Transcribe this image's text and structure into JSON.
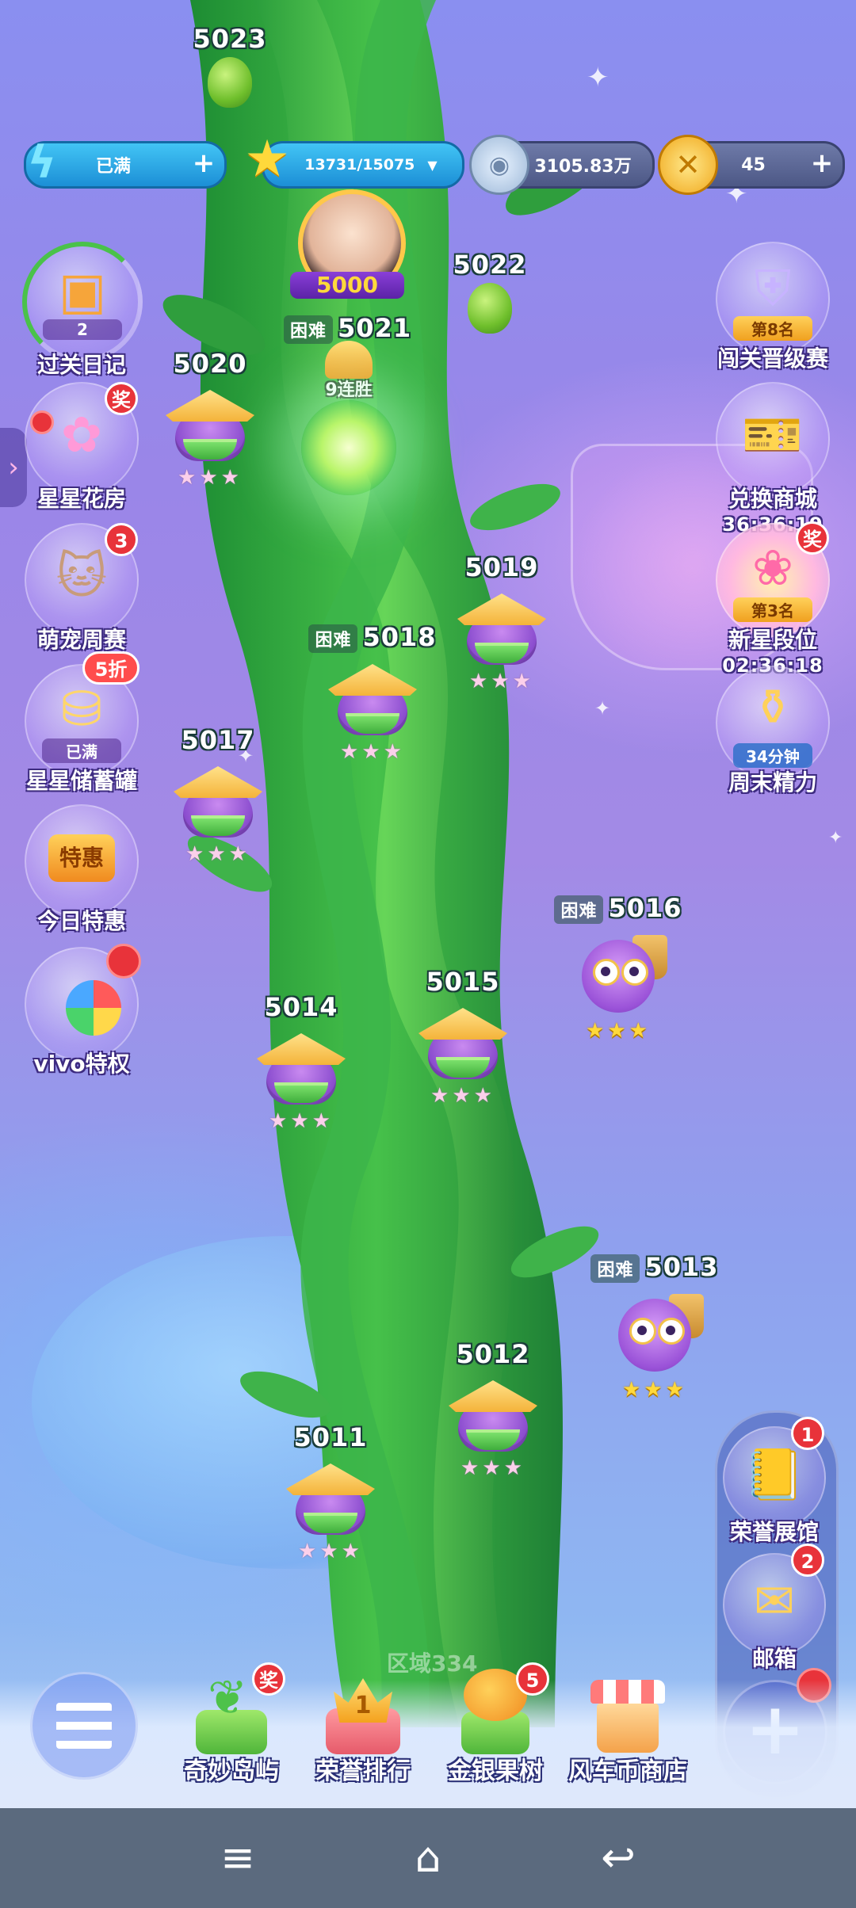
{
  "top_bar": {
    "energy": {
      "value": "已满",
      "icon": "lightning-icon"
    },
    "stars": {
      "value": "13731/15075",
      "icon": "star-icon"
    },
    "coins": {
      "value": "3105.83万",
      "icon": "silver-coin-icon"
    },
    "gold": {
      "value": "45",
      "icon": "gold-coin-icon"
    },
    "plus": "+"
  },
  "player": {
    "milestone": "5000",
    "difficulty": "困难",
    "current_level": "5021",
    "streak": "9连胜"
  },
  "levels": [
    {
      "num": "5023",
      "hard": ""
    },
    {
      "num": "5022",
      "hard": ""
    },
    {
      "num": "5020",
      "hard": ""
    },
    {
      "num": "5019",
      "hard": ""
    },
    {
      "num": "5018",
      "hard": "困难"
    },
    {
      "num": "5017",
      "hard": ""
    },
    {
      "num": "5016",
      "hard": "困难"
    },
    {
      "num": "5015",
      "hard": ""
    },
    {
      "num": "5014",
      "hard": ""
    },
    {
      "num": "5013",
      "hard": "困难"
    },
    {
      "num": "5012",
      "hard": ""
    },
    {
      "num": "5011",
      "hard": ""
    }
  ],
  "stars_glyph": "★★★",
  "left_menu": [
    {
      "label": "过关日记",
      "sub": "2"
    },
    {
      "label": "星星花房",
      "badge": "奖"
    },
    {
      "label": "萌宠周赛",
      "badge": "3"
    },
    {
      "label": "星星储蓄罐",
      "sub": "已满",
      "badge": "5折"
    },
    {
      "label": "今日特惠",
      "sub": "特惠"
    },
    {
      "label": "vivo特权"
    }
  ],
  "right_menu": [
    {
      "label": "闯关晋级赛",
      "sub": "第8名"
    },
    {
      "label": "兑换商城",
      "timer": "36:36:19"
    },
    {
      "label": "新星段位",
      "sub": "第3名",
      "timer": "02:36:18",
      "badge": "奖"
    },
    {
      "label": "周末精力",
      "sub": "34分钟"
    },
    {
      "label": "荣誉展馆",
      "badge": "1"
    },
    {
      "label": "邮箱",
      "badge": "2"
    }
  ],
  "area_label": "区域334",
  "bottom_menu": [
    {
      "label": "奇妙岛屿",
      "badge": "奖"
    },
    {
      "label": "荣誉排行",
      "sub": "1"
    },
    {
      "label": "金银果树",
      "badge": "5"
    },
    {
      "label": "风车币商店"
    }
  ],
  "colors": {
    "accent_blue": "#1c8fd6",
    "badge_red": "#e8333a",
    "stalk_green": "#2fa83a",
    "star_gold": "#ffd93b"
  }
}
